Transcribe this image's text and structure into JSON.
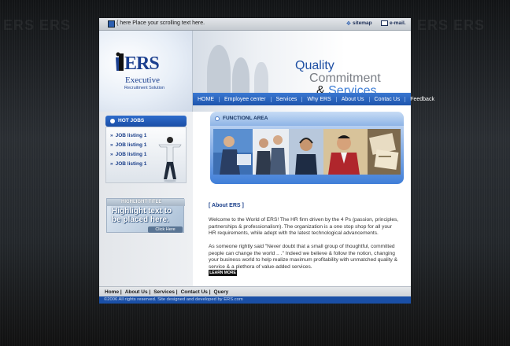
{
  "topbar": {
    "scroll_text": "{ here Place your scrolling text here.",
    "sitemap": "sitemap",
    "email": "e-mail."
  },
  "logo": {
    "mark": "ERS",
    "name": "Executive",
    "tagline": "Recruitment Solution"
  },
  "banner": {
    "line1": "Quality",
    "line2": "Commitment",
    "line3_amp": "&",
    "line3_services": "Services"
  },
  "nav": {
    "items": [
      "HOME",
      "Employee center",
      "Services",
      "Why ERS",
      "About Us",
      "Contac Us",
      "Feedback"
    ]
  },
  "hot_jobs": {
    "title": "HOT JOBS",
    "items": [
      "JOB listing 1",
      "JOB listing 1",
      "JOB listing 1",
      "JOB listing 1"
    ]
  },
  "highlight": {
    "title": "HIGHLIGHT TITLE",
    "text": "Highlight text to be placed here.",
    "click": "Click Here"
  },
  "functional": {
    "title": "FUNCTIONL AREA"
  },
  "about": {
    "heading": "[ About ERS ]",
    "p1": "Welcome to the World of ERS! The HR firm driven by the 4 Ps (passion, principles, partnerships & professionalism). The organization is a one stop shop for all your HR requirements, while adept with the latest technological advancements.",
    "p2": "As someone rightly said \"Never doubt that a small group of thoughtful, committed people can change the world .. .\" Indeed we believe & follow the notion, changing your business world to help realize maximum profitability with unmatched quality & service & a plethora of value-added services.",
    "learn_more": "LEARN MORE"
  },
  "footer": {
    "links": [
      "Home |",
      "About Us |",
      "Services |",
      "Contact Us |",
      "Query"
    ],
    "copyright": "©2006 All rights reserved. Site designed and developed by ERS.com"
  },
  "colors": {
    "brand_blue": "#1d54ad",
    "nav_blue": "#3b78d1",
    "background": "#1e2125"
  }
}
